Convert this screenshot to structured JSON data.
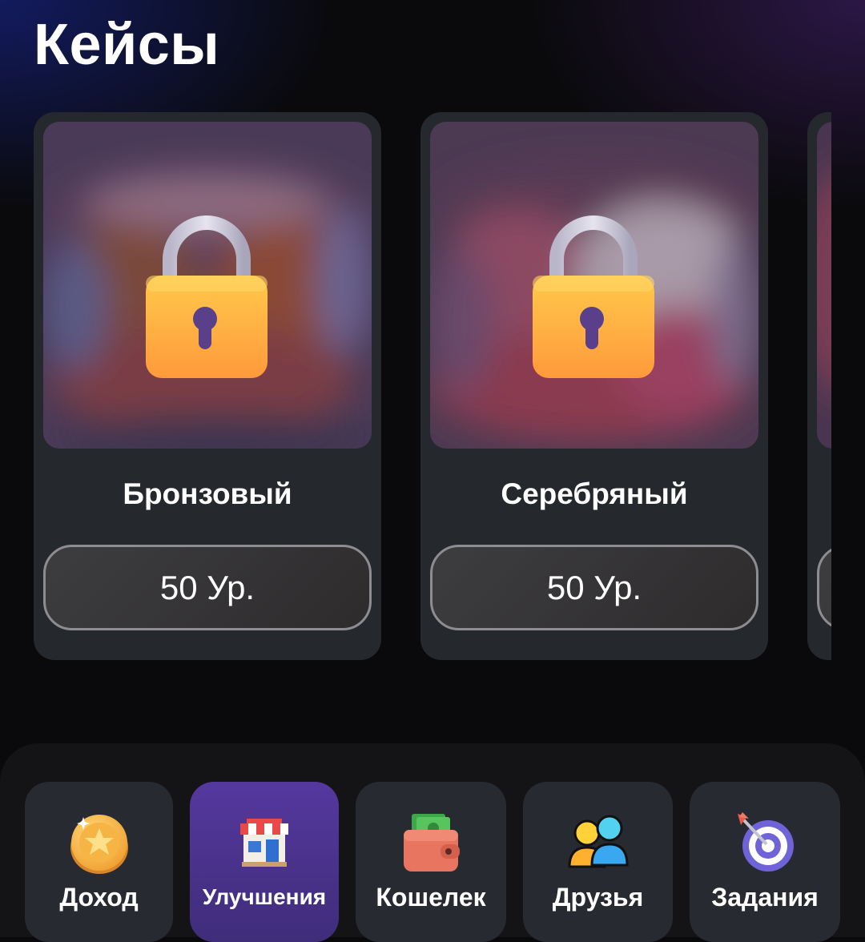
{
  "header": {
    "title": "Кейсы"
  },
  "cases": [
    {
      "name": "Бронзовый",
      "price": "50 Ур.",
      "locked": true,
      "icon": "lock-icon"
    },
    {
      "name": "Серебряный",
      "price": "50 Ур.",
      "locked": true,
      "icon": "lock-icon"
    }
  ],
  "nav": {
    "items": [
      {
        "label": "Доход",
        "icon": "gold-coin-icon",
        "active": false
      },
      {
        "label": "Улучшения",
        "icon": "shop-icon",
        "active": true
      },
      {
        "label": "Кошелек",
        "icon": "wallet-icon",
        "active": false
      },
      {
        "label": "Друзья",
        "icon": "friends-icon",
        "active": false
      },
      {
        "label": "Задания",
        "icon": "target-icon",
        "active": false
      }
    ]
  },
  "colors": {
    "background": "#0a0a0c",
    "card": "#25282d",
    "nav_active": "#55389e",
    "nav_item": "#282a31",
    "lock": "#ffb43a"
  }
}
